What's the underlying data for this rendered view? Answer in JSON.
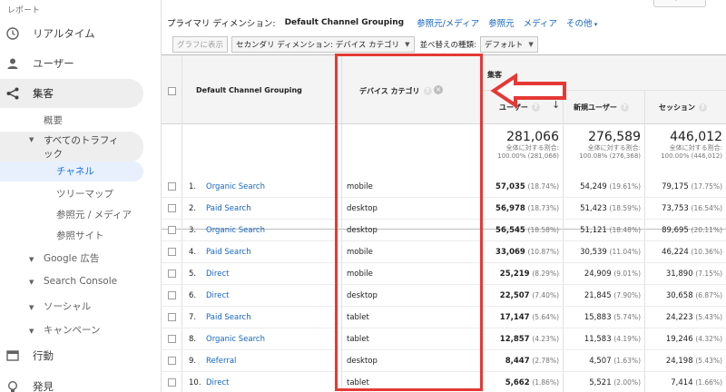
{
  "sidebar": {
    "header": "レポート",
    "items": [
      {
        "label": "リアルタイム",
        "icon": "clock-icon"
      },
      {
        "label": "ユーザー",
        "icon": "person-icon"
      },
      {
        "label": "集客",
        "icon": "acquisition-icon"
      }
    ],
    "acquisition_sub": {
      "overview": "概要",
      "all_traffic_line1": "すべてのトラフィ",
      "all_traffic_line2": "ック",
      "channels": "チャネル",
      "treemaps": "ツリーマップ",
      "source_medium": "参照元 / メディア",
      "referrals": "参照サイト",
      "google_ads": "Google 広告",
      "search_console": "Search Console",
      "social": "ソーシャル",
      "campaigns": "キャンペーン"
    },
    "behavior": {
      "label": "行動",
      "icon": "behavior-icon"
    },
    "conversions": {
      "label": "発見",
      "icon": "lightbulb-icon"
    }
  },
  "primary_dimension": {
    "label": "プライマリ ディメンション:",
    "current": "Default Channel Grouping",
    "links": [
      "参照元/メディア",
      "参照元",
      "メディア",
      "その他"
    ]
  },
  "toolbar": {
    "plot_rows": "グラフに表示",
    "secondary_dim": "セカンダリ ディメンション: デバイス カテゴリ",
    "sort_type_label": "並べ替えの種類:",
    "sort_type_value": "デフォルト"
  },
  "table": {
    "group_header": "集客",
    "col_channel": "Default Channel Grouping",
    "col_device": "デバイス カテゴリ",
    "col_users": "ユーザー",
    "col_new_users": "新規ユーザー",
    "col_sessions": "セッション",
    "totals": {
      "users": "281,066",
      "users_sub1": "全体に対する割合:",
      "users_sub2": "100.00% (281,066)",
      "new_users": "276,589",
      "new_users_sub1": "全体に対する割合:",
      "new_users_sub2": "100.08% (276,368)",
      "sessions": "446,012",
      "sessions_sub1": "全体に対する割合:",
      "sessions_sub2": "100.00% (446,012)"
    },
    "rows": [
      {
        "num": "1.",
        "channel": "Organic Search",
        "device": "mobile",
        "users": "57,035",
        "users_pct": "(18.74%)",
        "new_users": "54,249",
        "new_users_pct": "(19.61%)",
        "sessions": "79,175",
        "sessions_pct": "(17.75%)"
      },
      {
        "num": "2.",
        "channel": "Paid Search",
        "device": "desktop",
        "users": "56,978",
        "users_pct": "(18.73%)",
        "new_users": "51,423",
        "new_users_pct": "(18.59%)",
        "sessions": "73,753",
        "sessions_pct": "(16.54%)"
      },
      {
        "num": "3.",
        "channel": "Organic Search",
        "device": "desktop",
        "users": "56,545",
        "users_pct": "(18.58%)",
        "new_users": "51,121",
        "new_users_pct": "(18.48%)",
        "sessions": "89,695",
        "sessions_pct": "(20.11%)"
      },
      {
        "num": "4.",
        "channel": "Paid Search",
        "device": "mobile",
        "users": "33,069",
        "users_pct": "(10.87%)",
        "new_users": "30,539",
        "new_users_pct": "(11.04%)",
        "sessions": "46,224",
        "sessions_pct": "(10.36%)"
      },
      {
        "num": "5.",
        "channel": "Direct",
        "device": "mobile",
        "users": "25,219",
        "users_pct": "(8.29%)",
        "new_users": "24,909",
        "new_users_pct": "(9.01%)",
        "sessions": "31,890",
        "sessions_pct": "(7.15%)"
      },
      {
        "num": "6.",
        "channel": "Direct",
        "device": "desktop",
        "users": "22,507",
        "users_pct": "(7.40%)",
        "new_users": "21,845",
        "new_users_pct": "(7.90%)",
        "sessions": "30,658",
        "sessions_pct": "(6.87%)"
      },
      {
        "num": "7.",
        "channel": "Paid Search",
        "device": "tablet",
        "users": "17,147",
        "users_pct": "(5.64%)",
        "new_users": "15,883",
        "new_users_pct": "(5.74%)",
        "sessions": "24,223",
        "sessions_pct": "(5.43%)"
      },
      {
        "num": "8.",
        "channel": "Organic Search",
        "device": "tablet",
        "users": "12,857",
        "users_pct": "(4.23%)",
        "new_users": "11,583",
        "new_users_pct": "(4.19%)",
        "sessions": "19,246",
        "sessions_pct": "(4.32%)"
      },
      {
        "num": "9.",
        "channel": "Referral",
        "device": "desktop",
        "users": "8,447",
        "users_pct": "(2.78%)",
        "new_users": "4,507",
        "new_users_pct": "(1.63%)",
        "sessions": "24,198",
        "sessions_pct": "(5.43%)"
      },
      {
        "num": "10.",
        "channel": "Direct",
        "device": "tablet",
        "users": "5,662",
        "users_pct": "(1.86%)",
        "new_users": "5,521",
        "new_users_pct": "(2.00%)",
        "sessions": "7,414",
        "sessions_pct": "(1.66%)"
      }
    ]
  },
  "colors": {
    "annotation_red": "#e53935",
    "link_blue": "#1565c0"
  }
}
